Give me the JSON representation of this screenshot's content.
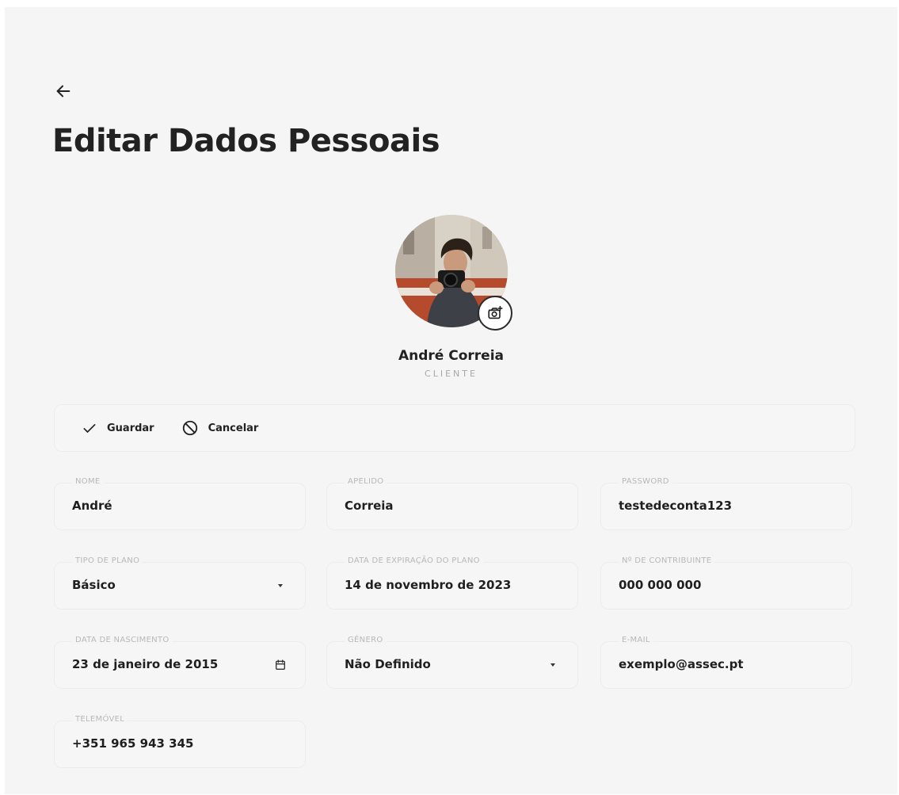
{
  "header": {
    "back_icon": "arrow-left-icon",
    "title": "Editar Dados Pessoais"
  },
  "profile": {
    "name": "André Correia",
    "role": "CLIENTE",
    "camera_icon": "camera-add-icon"
  },
  "toolbar": {
    "save_label": "Guardar",
    "save_icon": "check-icon",
    "cancel_label": "Cancelar",
    "cancel_icon": "ban-icon"
  },
  "fields": {
    "nome": {
      "label": "NOME",
      "value": "André"
    },
    "apelido": {
      "label": "APELIDO",
      "value": "Correia"
    },
    "password": {
      "label": "PASSWORD",
      "value": "testedeconta123"
    },
    "tipo_plano": {
      "label": "TIPO DE PLANO",
      "value": "Básico",
      "icon": "chevron-down-icon"
    },
    "data_expiracao": {
      "label": "DATA DE EXPIRAÇÃO DO PLANO",
      "value": "14 de novembro de 2023"
    },
    "contribuinte": {
      "label": "Nº DE CONTRIBUINTE",
      "value": "000 000 000"
    },
    "data_nascimento": {
      "label": "DATA DE NASCIMENTO",
      "value": "23 de janeiro de 2015",
      "icon": "calendar-icon"
    },
    "genero": {
      "label": "GÉNERO",
      "value": "Não Definido",
      "icon": "chevron-down-icon"
    },
    "email": {
      "label": "E-MAIL",
      "value": "exemplo@assec.pt"
    },
    "telemovel": {
      "label": "TELEMÓVEL",
      "value": "+351 965 943 345"
    }
  },
  "colors": {
    "page_bg": "#f5f5f5",
    "field_border": "#ececec",
    "label_text": "#b8b8b8",
    "primary_text": "#1f1f1f"
  }
}
